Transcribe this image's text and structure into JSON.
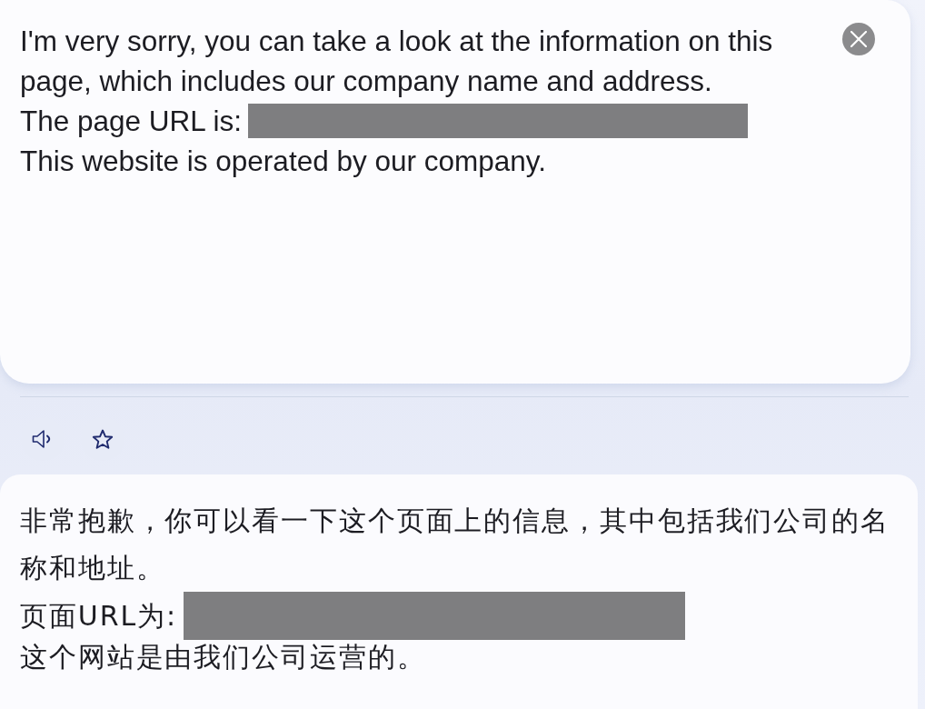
{
  "reply_card": {
    "paragraph": "I'm very sorry, you can take a look at the information on this page, which includes our company name and address.",
    "url_label": "The page URL is:",
    "url_redacted": true,
    "closing": "This website is operated by our company."
  },
  "translation_card": {
    "paragraph": "非常抱歉，你可以看一下这个页面上的信息，其中包括我们公司的名称和地址。",
    "url_label": "页面URL为:",
    "url_redacted": true,
    "closing": "这个网站是由我们公司运营的。"
  }
}
